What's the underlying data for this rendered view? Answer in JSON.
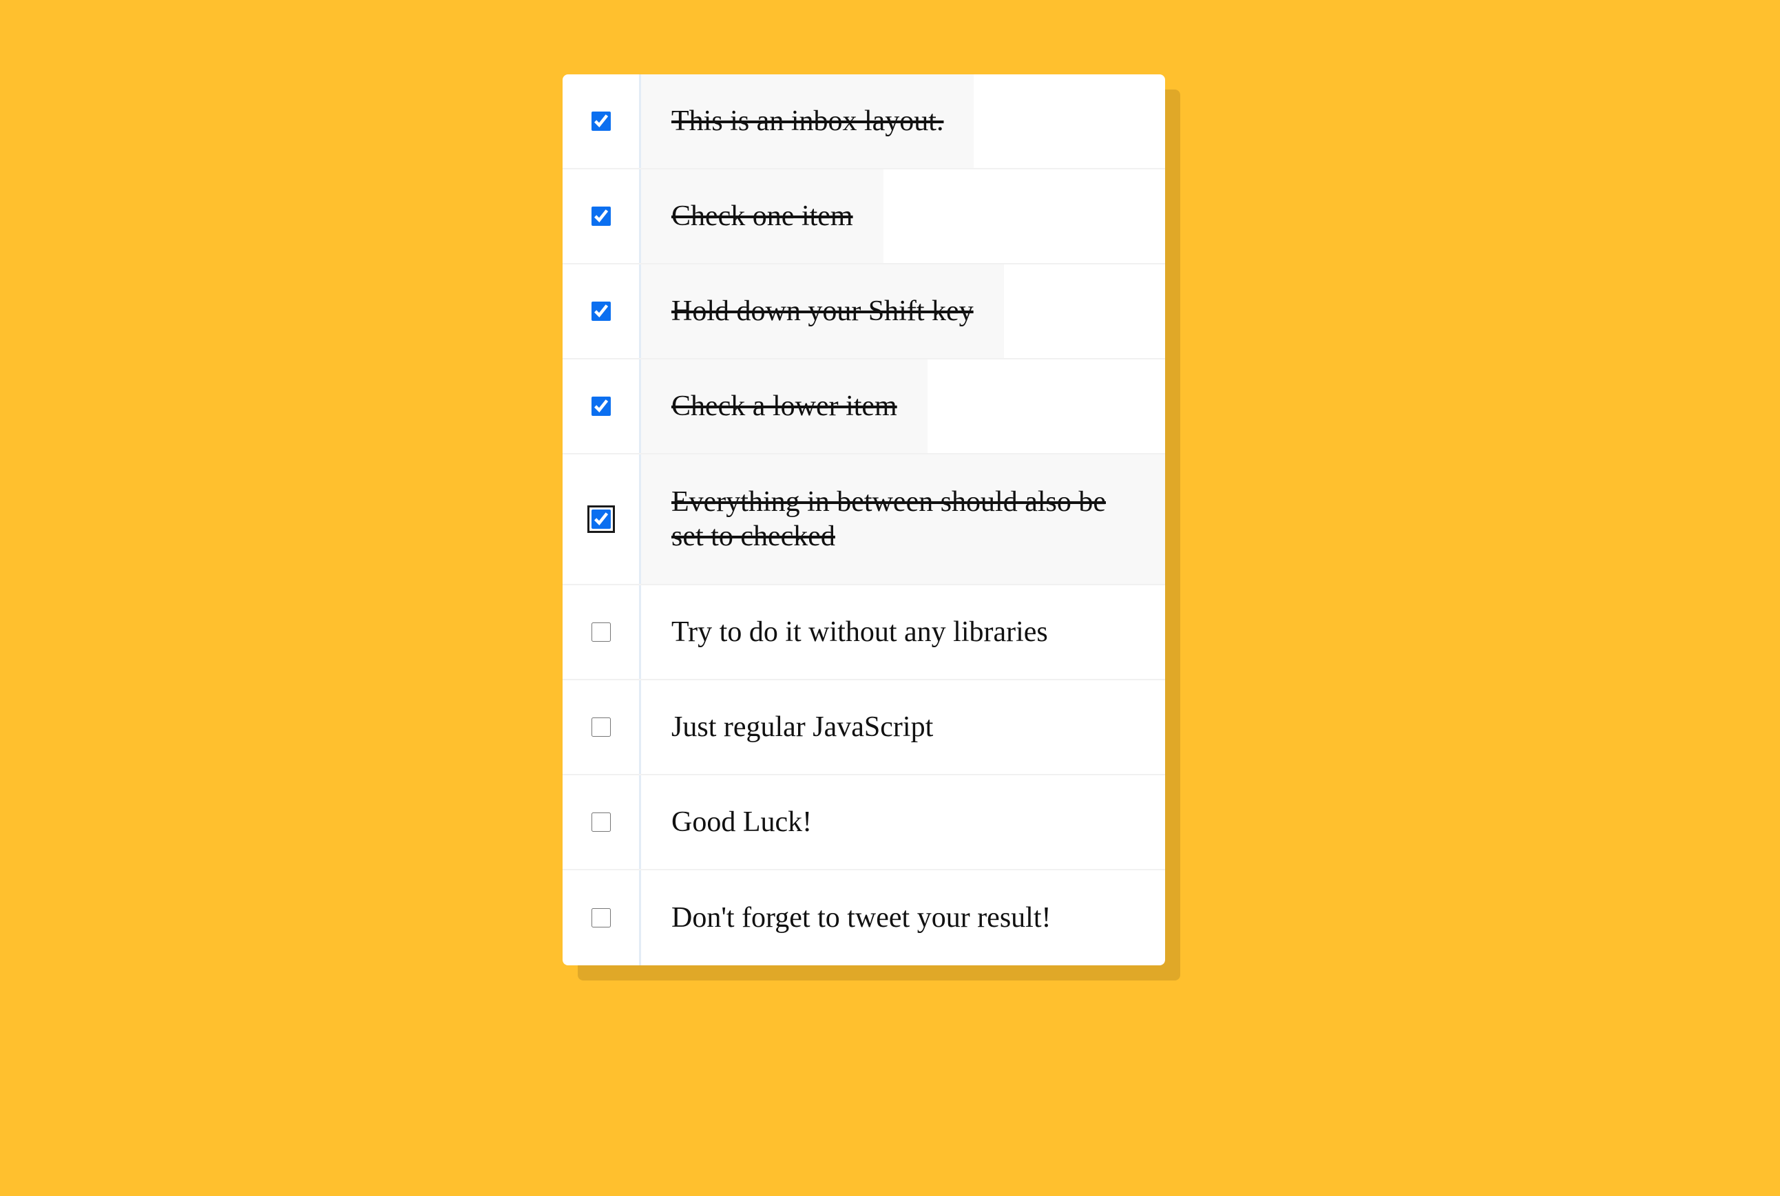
{
  "colors": {
    "background": "#ffc02e",
    "card": "#ffffff",
    "checked_row_bg": "#f8f8f8",
    "checkbox_accent": "#0b6ff0"
  },
  "items": [
    {
      "label": "This is an inbox layout.",
      "checked": true
    },
    {
      "label": "Check one item",
      "checked": true
    },
    {
      "label": "Hold down your Shift key",
      "checked": true
    },
    {
      "label": "Check a lower item",
      "checked": true
    },
    {
      "label": "Everything in between should also be set to checked",
      "checked": true,
      "focused": true
    },
    {
      "label": "Try to do it without any libraries",
      "checked": false
    },
    {
      "label": "Just regular JavaScript",
      "checked": false
    },
    {
      "label": "Good Luck!",
      "checked": false
    },
    {
      "label": "Don't forget to tweet your result!",
      "checked": false
    }
  ]
}
